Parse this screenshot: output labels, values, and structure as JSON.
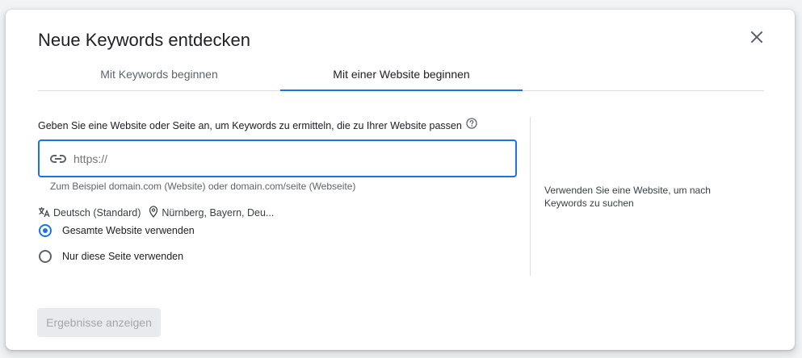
{
  "dialog": {
    "title": "Neue Keywords entdecken",
    "close_icon": "close-icon"
  },
  "tabs": [
    {
      "label": "Mit Keywords beginnen",
      "active": false
    },
    {
      "label": "Mit einer Website beginnen",
      "active": true
    }
  ],
  "form": {
    "prompt": "Geben Sie eine Website oder Seite an, um Keywords zu ermitteln, die zu Ihrer Website passen",
    "help_icon": "help-circle-icon",
    "url_input": {
      "placeholder": "https://",
      "value": "",
      "icon": "link-icon"
    },
    "hint": "Zum Beispiel domain.com (Website) oder domain.com/seite (Webseite)",
    "language": {
      "icon": "translate-icon",
      "label": "Deutsch (Standard)"
    },
    "location": {
      "icon": "location-pin-icon",
      "label": "Nürnberg, Bayern, Deu..."
    },
    "scope_options": [
      {
        "label": "Gesamte Website verwenden",
        "selected": true
      },
      {
        "label": "Nur diese Seite verwenden",
        "selected": false
      }
    ]
  },
  "side_note": "Verwenden Sie eine Website, um nach Keywords zu suchen",
  "actions": {
    "results_label": "Ergebnisse anzeigen",
    "results_enabled": false
  },
  "colors": {
    "accent": "#1a73e8",
    "text_primary": "#202124",
    "text_secondary": "#5f6368",
    "disabled_bg": "#e8eaed",
    "disabled_text": "#a4a6a9"
  }
}
